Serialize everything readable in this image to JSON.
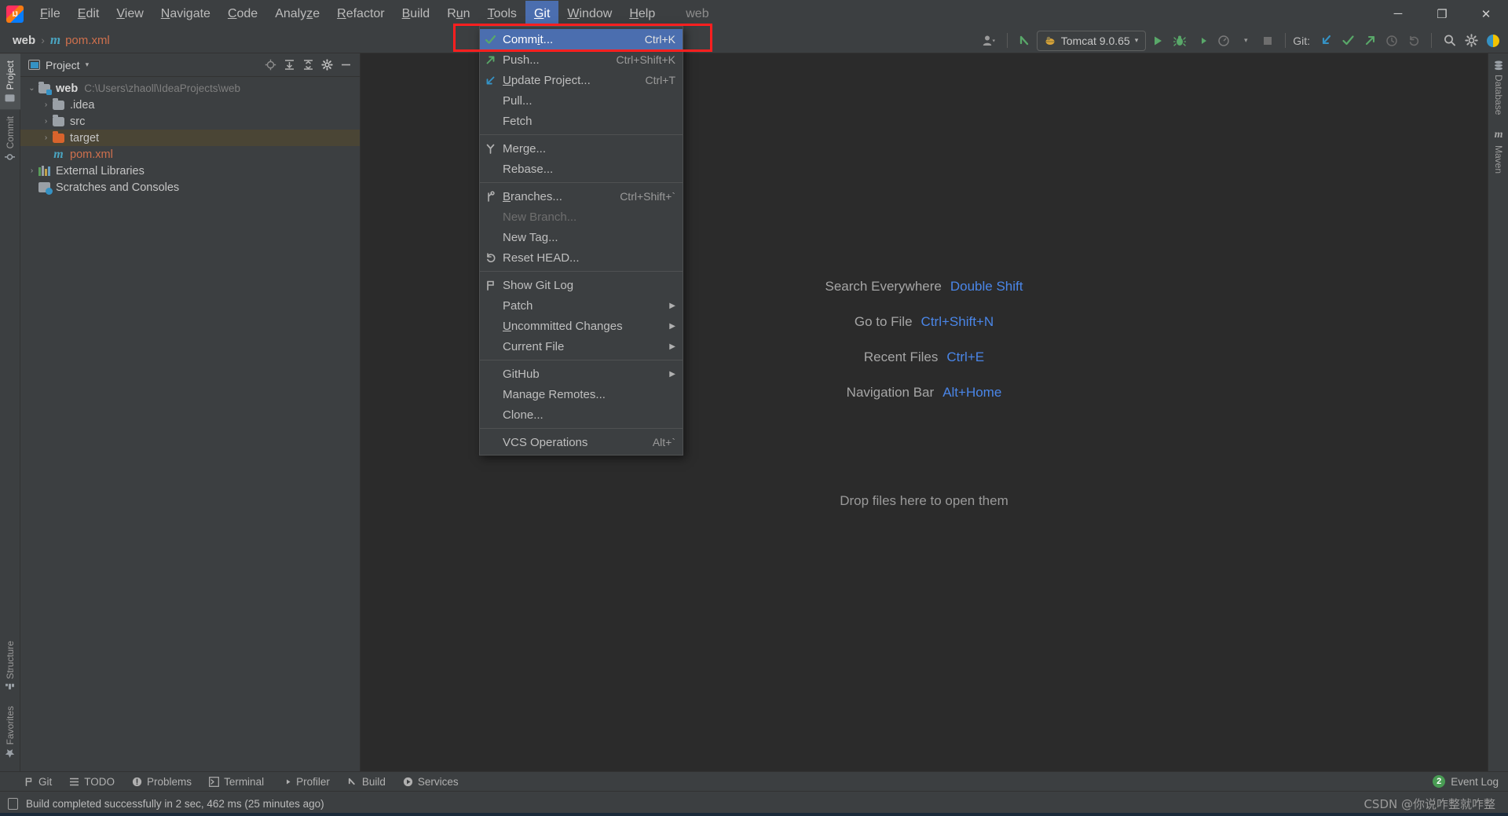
{
  "window": {
    "app_logo": "intellij-idea-logo",
    "project_name": "web",
    "minimize_label": "─",
    "maximize_label": "❐",
    "close_label": "✕"
  },
  "menubar": {
    "items": [
      {
        "label": "File",
        "mnemonic": "F"
      },
      {
        "label": "Edit",
        "mnemonic": "E"
      },
      {
        "label": "View",
        "mnemonic": "V"
      },
      {
        "label": "Navigate",
        "mnemonic": "N"
      },
      {
        "label": "Code",
        "mnemonic": "C"
      },
      {
        "label": "Analyze",
        "mnemonic": "z"
      },
      {
        "label": "Refactor",
        "mnemonic": "R"
      },
      {
        "label": "Build",
        "mnemonic": "B"
      },
      {
        "label": "Run",
        "mnemonic": "u"
      },
      {
        "label": "Tools",
        "mnemonic": "T"
      },
      {
        "label": "Git",
        "mnemonic": "G",
        "active": true
      },
      {
        "label": "Window",
        "mnemonic": "W"
      },
      {
        "label": "Help",
        "mnemonic": "H"
      }
    ]
  },
  "breadcrumb": {
    "root": "web",
    "separator": "›",
    "file_icon": "m",
    "file": "pom.xml"
  },
  "toolbar": {
    "user_icon": "user-account-icon",
    "back_icon": "back-arrow-icon",
    "run_config": "Tomcat 9.0.65",
    "run_config_icon": "tomcat-icon",
    "dropdown_caret": "▾",
    "run_icon": "run-icon",
    "debug_icon": "debug-icon",
    "run_coverage_icon": "run-with-coverage-icon",
    "profile_icon": "profiler-icon",
    "stop_icon": "stop-icon",
    "git_label": "Git:",
    "git_update_icon": "update-project-icon",
    "git_commit_icon": "commit-icon",
    "git_push_icon": "push-icon",
    "git_history_icon": "history-icon",
    "git_rollback_icon": "rollback-icon",
    "search_icon": "search-icon",
    "settings_icon": "gear-icon",
    "avatar_icon": "ide-avatar-icon"
  },
  "git_menu": {
    "groups": [
      {
        "items": [
          {
            "label": "Commit...",
            "shortcut": "Ctrl+K",
            "icon": "green-check-icon",
            "highlighted": true,
            "mnemonic": "i"
          },
          {
            "label": "Push...",
            "shortcut": "Ctrl+Shift+K",
            "icon": "green-arrow-up-right-icon"
          },
          {
            "label": "Update Project...",
            "shortcut": "Ctrl+T",
            "icon": "blue-arrow-down-left-icon",
            "mnemonic": "U"
          },
          {
            "label": "Pull...",
            "shortcut": "",
            "icon": ""
          },
          {
            "label": "Fetch",
            "shortcut": "",
            "icon": ""
          }
        ]
      },
      {
        "items": [
          {
            "label": "Merge...",
            "shortcut": "",
            "icon": "merge-icon"
          },
          {
            "label": "Rebase...",
            "shortcut": "",
            "icon": ""
          }
        ]
      },
      {
        "items": [
          {
            "label": "Branches...",
            "shortcut": "Ctrl+Shift+`",
            "icon": "branch-icon",
            "mnemonic": "B"
          },
          {
            "label": "New Branch...",
            "shortcut": "",
            "icon": "",
            "disabled": true
          },
          {
            "label": "New Tag...",
            "shortcut": "",
            "icon": ""
          },
          {
            "label": "Reset HEAD...",
            "shortcut": "",
            "icon": "reset-icon"
          }
        ]
      },
      {
        "items": [
          {
            "label": "Show Git Log",
            "shortcut": "",
            "icon": "git-log-icon"
          },
          {
            "label": "Patch",
            "shortcut": "",
            "icon": "",
            "submenu": true
          },
          {
            "label": "Uncommitted Changes",
            "shortcut": "",
            "icon": "",
            "submenu": true,
            "mnemonic": "U"
          },
          {
            "label": "Current File",
            "shortcut": "",
            "icon": "",
            "submenu": true
          }
        ]
      },
      {
        "items": [
          {
            "label": "GitHub",
            "shortcut": "",
            "icon": "",
            "submenu": true
          },
          {
            "label": "Manage Remotes...",
            "shortcut": "",
            "icon": ""
          },
          {
            "label": "Clone...",
            "shortcut": "",
            "icon": ""
          }
        ]
      },
      {
        "items": [
          {
            "label": "VCS Operations",
            "shortcut": "Alt+`",
            "icon": ""
          }
        ]
      }
    ]
  },
  "project_panel": {
    "title": "Project",
    "caret": "▾",
    "actions": [
      "locate-icon",
      "expand-all-icon",
      "collapse-all-icon",
      "gear-icon",
      "hide-icon"
    ],
    "tree": [
      {
        "label": "web",
        "path": "C:\\Users\\zhaoll\\IdeaProjects\\web",
        "arrow": "⌄",
        "icon": "module-folder-icon",
        "depth": 0,
        "bold": true
      },
      {
        "label": ".idea",
        "path": "",
        "arrow": "›",
        "icon": "folder-icon",
        "depth": 1
      },
      {
        "label": "src",
        "path": "",
        "arrow": "›",
        "icon": "folder-icon",
        "depth": 1
      },
      {
        "label": "target",
        "path": "",
        "arrow": "›",
        "icon": "folder-orange-icon",
        "depth": 1,
        "selected": true
      },
      {
        "label": "pom.xml",
        "path": "",
        "arrow": "",
        "icon": "maven-file-icon",
        "depth": 1,
        "file": true
      },
      {
        "label": "External Libraries",
        "path": "",
        "arrow": "›",
        "icon": "library-icon",
        "depth": 0
      },
      {
        "label": "Scratches and Consoles",
        "path": "",
        "arrow": "",
        "icon": "scratches-icon",
        "depth": 0
      }
    ]
  },
  "left_toolwindows": {
    "top": [
      {
        "label": "Project",
        "icon": "project-icon",
        "selected": true
      },
      {
        "label": "Commit",
        "icon": "commit-icon"
      }
    ],
    "bottom": [
      {
        "label": "Structure",
        "icon": "structure-icon"
      },
      {
        "label": "Favorites",
        "icon": "star-icon"
      }
    ]
  },
  "right_toolwindows": {
    "items": [
      {
        "label": "Database",
        "icon": "database-icon"
      },
      {
        "label": "Maven",
        "icon": "maven-icon"
      }
    ]
  },
  "editor": {
    "hints": [
      {
        "text": "Search Everywhere",
        "key": "Double Shift"
      },
      {
        "text": "Go to File",
        "key": "Ctrl+Shift+N"
      },
      {
        "text": "Recent Files",
        "key": "Ctrl+E"
      },
      {
        "text": "Navigation Bar",
        "key": "Alt+Home"
      }
    ],
    "drop_hint": "Drop files here to open them"
  },
  "bottom_toolwindows": {
    "items": [
      {
        "label": "Git",
        "icon": "git-icon"
      },
      {
        "label": "TODO",
        "icon": "todo-icon"
      },
      {
        "label": "Problems",
        "icon": "problems-icon"
      },
      {
        "label": "Terminal",
        "icon": "terminal-icon"
      },
      {
        "label": "Profiler",
        "icon": "profiler-icon"
      },
      {
        "label": "Build",
        "icon": "build-icon"
      },
      {
        "label": "Services",
        "icon": "services-icon"
      }
    ],
    "event_log": {
      "label": "Event Log",
      "count": "2"
    }
  },
  "statusbar": {
    "icon": "build-status-icon",
    "message": "Build completed successfully in 2 sec, 462 ms (25 minutes ago)",
    "watermark": "CSDN @你说咋整就咋整"
  },
  "colors": {
    "accent_blue": "#4b6eaf",
    "link_blue": "#4a86e8",
    "panel_bg": "#3c3f41",
    "editor_bg": "#2b2b2b",
    "annotation_red": "#ff1f1f",
    "selection_tree": "#4a4535",
    "green": "#499c54"
  }
}
